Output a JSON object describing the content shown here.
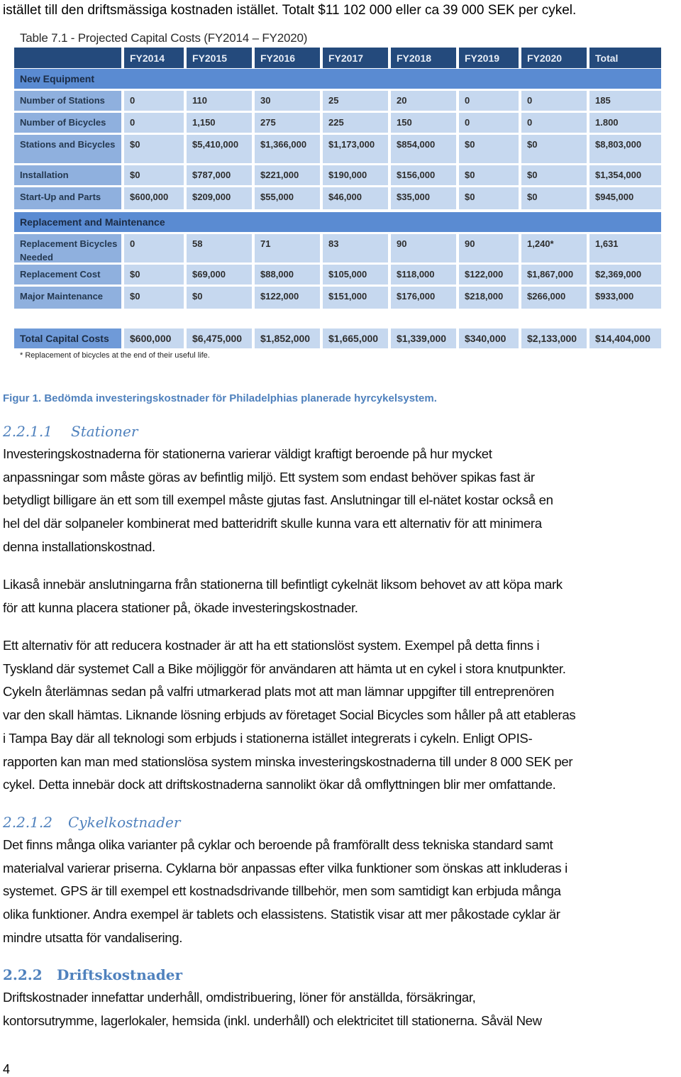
{
  "lead_line": "istället till den driftsmässiga kostnaden istället. Totalt $11 102 000 eller ca 39 000 SEK per cykel.",
  "table": {
    "title": "Table 7.1 - Projected Capital Costs (FY2014 – FY2020)",
    "headers": [
      "",
      "FY2014",
      "FY2015",
      "FY2016",
      "FY2017",
      "FY2018",
      "FY2019",
      "FY2020",
      "Total"
    ],
    "sections": [
      {
        "title": "New Equipment",
        "rows": [
          {
            "label": "Number of Stations",
            "values": [
              "0",
              "110",
              "30",
              "25",
              "20",
              "0",
              "0",
              "185"
            ]
          },
          {
            "label": "Number of Bicycles",
            "values": [
              "0",
              "1,150",
              "275",
              "225",
              "150",
              "0",
              "0",
              "1.800"
            ]
          },
          {
            "label": "Stations and Bicycles",
            "values": [
              "$0",
              "$5,410,000",
              "$1,366,000",
              "$1,173,000",
              "$854,000",
              "$0",
              "$0",
              "$8,803,000"
            ]
          },
          {
            "label": "Installation",
            "values": [
              "$0",
              "$787,000",
              "$221,000",
              "$190,000",
              "$156,000",
              "$0",
              "$0",
              "$1,354,000"
            ]
          },
          {
            "label": "Start-Up and Parts",
            "values": [
              "$600,000",
              "$209,000",
              "$55,000",
              "$46,000",
              "$35,000",
              "$0",
              "$0",
              "$945,000"
            ]
          }
        ]
      },
      {
        "title": "Replacement and Maintenance",
        "rows": [
          {
            "label": "Replacement Bicycles Needed",
            "values": [
              "0",
              "58",
              "71",
              "83",
              "90",
              "90",
              "1,240*",
              "1,631"
            ]
          },
          {
            "label": "Replacement Cost",
            "values": [
              "$0",
              "$69,000",
              "$88,000",
              "$105,000",
              "$118,000",
              "$122,000",
              "$1,867,000",
              "$2,369,000"
            ]
          },
          {
            "label": "Major Maintenance",
            "values": [
              "$0",
              "$0",
              "$122,000",
              "$151,000",
              "$176,000",
              "$218,000",
              "$266,000",
              "$933,000"
            ]
          }
        ]
      }
    ],
    "total_row": {
      "label": "Total Capital Costs",
      "values": [
        "$600,000",
        "$6,475,000",
        "$1,852,000",
        "$1,665,000",
        "$1,339,000",
        "$340,000",
        "$2,133,000",
        "$14,404,000"
      ]
    },
    "footnote": "* Replacement of bicycles at the end of their useful life."
  },
  "caption": "Figur 1. Bedömda investeringskostnader för Philadelphias planerade hyrcykelsystem.",
  "sections": [
    {
      "number": "2.2.1.1",
      "title": "Stationer",
      "paragraphs": [
        [
          "Investeringskostnaderna för stationerna varierar väldigt kraftigt beroende på hur mycket",
          "anpassningar som måste göras av befintlig miljö. Ett system som endast behöver spikas fast är",
          "betydligt billigare än ett som till exempel måste gjutas fast. Anslutningar till el-nätet kostar också en",
          "hel del där solpaneler kombinerat med batteridrift skulle kunna vara ett alternativ för att minimera",
          "denna installationskostnad."
        ],
        [
          "Likaså innebär anslutningarna från stationerna till befintligt cykelnät liksom behovet av att köpa mark",
          "för att kunna placera stationer på, ökade investeringskostnader."
        ],
        [
          "Ett alternativ för att reducera kostnader är att ha ett stationslöst system. Exempel på detta finns i",
          "Tyskland där systemet Call a Bike möjliggör för användaren att hämta ut en cykel i stora knutpunkter.",
          "Cykeln återlämnas sedan på valfri utmarkerad plats mot att man lämnar uppgifter till entreprenören",
          "var den skall hämtas. Liknande lösning erbjuds av företaget Social Bicycles som håller på att etableras",
          "i Tampa Bay där all teknologi som erbjuds i stationerna istället integrerats i cykeln. Enligt OPIS-",
          "rapporten kan man med stationslösa system minska investeringskostnaderna till under 8 000 SEK per",
          "cykel. Detta innebär dock att driftskostnaderna sannolikt ökar då omflyttningen blir mer omfattande."
        ]
      ]
    },
    {
      "number": "2.2.1.2",
      "title": "Cykelkostnader",
      "paragraphs": [
        [
          "Det finns många olika varianter på cyklar och beroende på framförallt dess tekniska standard samt",
          "materialval varierar priserna. Cyklarna bör anpassas efter vilka funktioner som önskas att inkluderas i",
          "systemet. GPS är till exempel ett kostnadsdrivande tillbehör, men som samtidigt kan erbjuda många",
          "olika funktioner. Andra exempel är tablets och elassistens. Statistik visar att mer påkostade cyklar är",
          "mindre utsatta för vandalisering."
        ]
      ]
    },
    {
      "number": "2.2.2",
      "title": "Driftskostnader",
      "paragraphs": [
        [
          "Driftskostnader innefattar underhåll, omdistribuering, löner för anställda, försäkringar,",
          "kontorsutrymme, lagerlokaler, hemsida (inkl. underhåll) och elektricitet till stationerna. Såväl New"
        ]
      ]
    }
  ],
  "page_number": "4"
}
